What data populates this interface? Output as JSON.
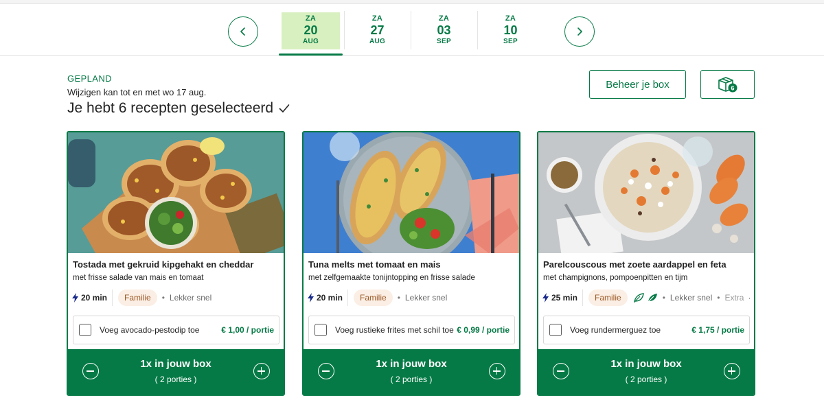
{
  "weeknav": {
    "weeks": [
      {
        "day": "ZA",
        "date": "20",
        "month": "AUG"
      },
      {
        "day": "ZA",
        "date": "27",
        "month": "AUG"
      },
      {
        "day": "ZA",
        "date": "03",
        "month": "SEP"
      },
      {
        "day": "ZA",
        "date": "10",
        "month": "SEP"
      }
    ],
    "active_index": 0
  },
  "header": {
    "status": "GEPLAND",
    "deadline": "Wijzigen kan tot en met wo 17 aug.",
    "selected": "Je hebt 6 recepten geselecteerd",
    "manage_button": "Beheer je box",
    "box_count": "6"
  },
  "cards": [
    {
      "title": "Tostada met gekruid kipgehakt en cheddar",
      "subtitle": "met frisse salade van mais en tomaat",
      "time": "20 min",
      "tag": "Familie",
      "feature": "Lekker snel",
      "addon_label": "Voeg avocado-pestodip toe",
      "addon_price": "€ 1,00 / portie",
      "quantity": "1x in jouw box",
      "portions": "( 2 porties )"
    },
    {
      "title": "Tuna melts met tomaat en mais",
      "subtitle": "met zelfgemaakte tonijntopping en frisse salade",
      "time": "20 min",
      "tag": "Familie",
      "feature": "Lekker snel",
      "addon_label": "Voeg rustieke frites met schil toe",
      "addon_price": "€ 0,99 / portie",
      "quantity": "1x in jouw box",
      "portions": "( 2 porties )"
    },
    {
      "title": "Parelcouscous met zoete aardappel en feta",
      "subtitle": "met champignons, pompoenpitten en tijm",
      "time": "25 min",
      "tag": "Familie",
      "feature": "Lekker snel",
      "extra": "Extra",
      "more": "···",
      "addon_label": "Voeg rundermerguez toe",
      "addon_price": "€ 1,75 / portie",
      "quantity": "1x in jouw box",
      "portions": "( 2 porties )"
    }
  ],
  "colors": {
    "brand_green": "#067a46",
    "active_week_bg": "#d8f0bf",
    "tag_bg": "#fbeee4",
    "tag_text": "#9b5a27",
    "lightning": "#1a2a8c"
  },
  "icons": {
    "prev": "chevron-left-icon",
    "next": "chevron-right-icon",
    "check": "check-icon",
    "box": "box-icon",
    "time": "lightning-icon",
    "veggie": "leaf-icon"
  }
}
